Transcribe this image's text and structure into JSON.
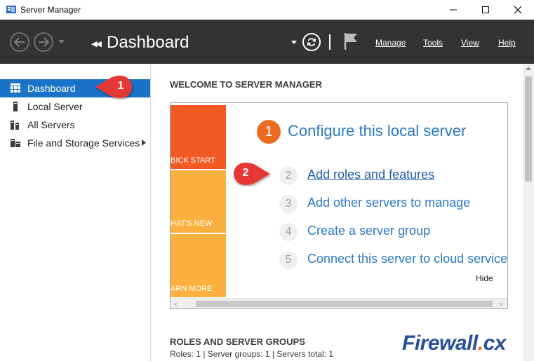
{
  "window": {
    "title": "Server Manager"
  },
  "header": {
    "page_title": "Dashboard",
    "menu": {
      "manage": "Manage",
      "tools": "Tools",
      "view": "View",
      "help": "Help"
    }
  },
  "sidebar": {
    "items": [
      {
        "label": "Dashboard",
        "icon": "dashboard-grid-icon",
        "active": true
      },
      {
        "label": "Local Server",
        "icon": "server-icon",
        "active": false
      },
      {
        "label": "All Servers",
        "icon": "servers-icon",
        "active": false
      },
      {
        "label": "File and Storage Services",
        "icon": "storage-icon",
        "active": false
      }
    ]
  },
  "callouts": {
    "one": "1",
    "two": "2",
    "color": "#e53935"
  },
  "welcome": {
    "heading": "WELCOME TO SERVER MANAGER",
    "tiles": {
      "quick_start": "BICK START",
      "whats_new": "HAT'S NEW",
      "learn_more": "ARN MORE"
    },
    "main_step": {
      "number": "1",
      "label": "Configure this local server"
    },
    "steps": [
      {
        "number": "2",
        "label": "Add roles and features"
      },
      {
        "number": "3",
        "label": "Add other servers to manage"
      },
      {
        "number": "4",
        "label": "Create a server group"
      },
      {
        "number": "5",
        "label": "Connect this server to cloud services"
      }
    ],
    "hide": "Hide"
  },
  "roles": {
    "heading": "ROLES AND SERVER GROUPS",
    "stats": "Roles: 1   |   Server groups: 1   |   Servers total: 1"
  },
  "watermark": {
    "brand": "Firewall",
    "dot": ".",
    "tld": "cx"
  },
  "colors": {
    "header_bg": "#333333",
    "active_item": "#1a73c8",
    "accent_orange": "#ec6b23",
    "tile_orange_dark": "#f15a22",
    "tile_orange_light": "#fbb040",
    "link_blue": "#2b79c2"
  }
}
